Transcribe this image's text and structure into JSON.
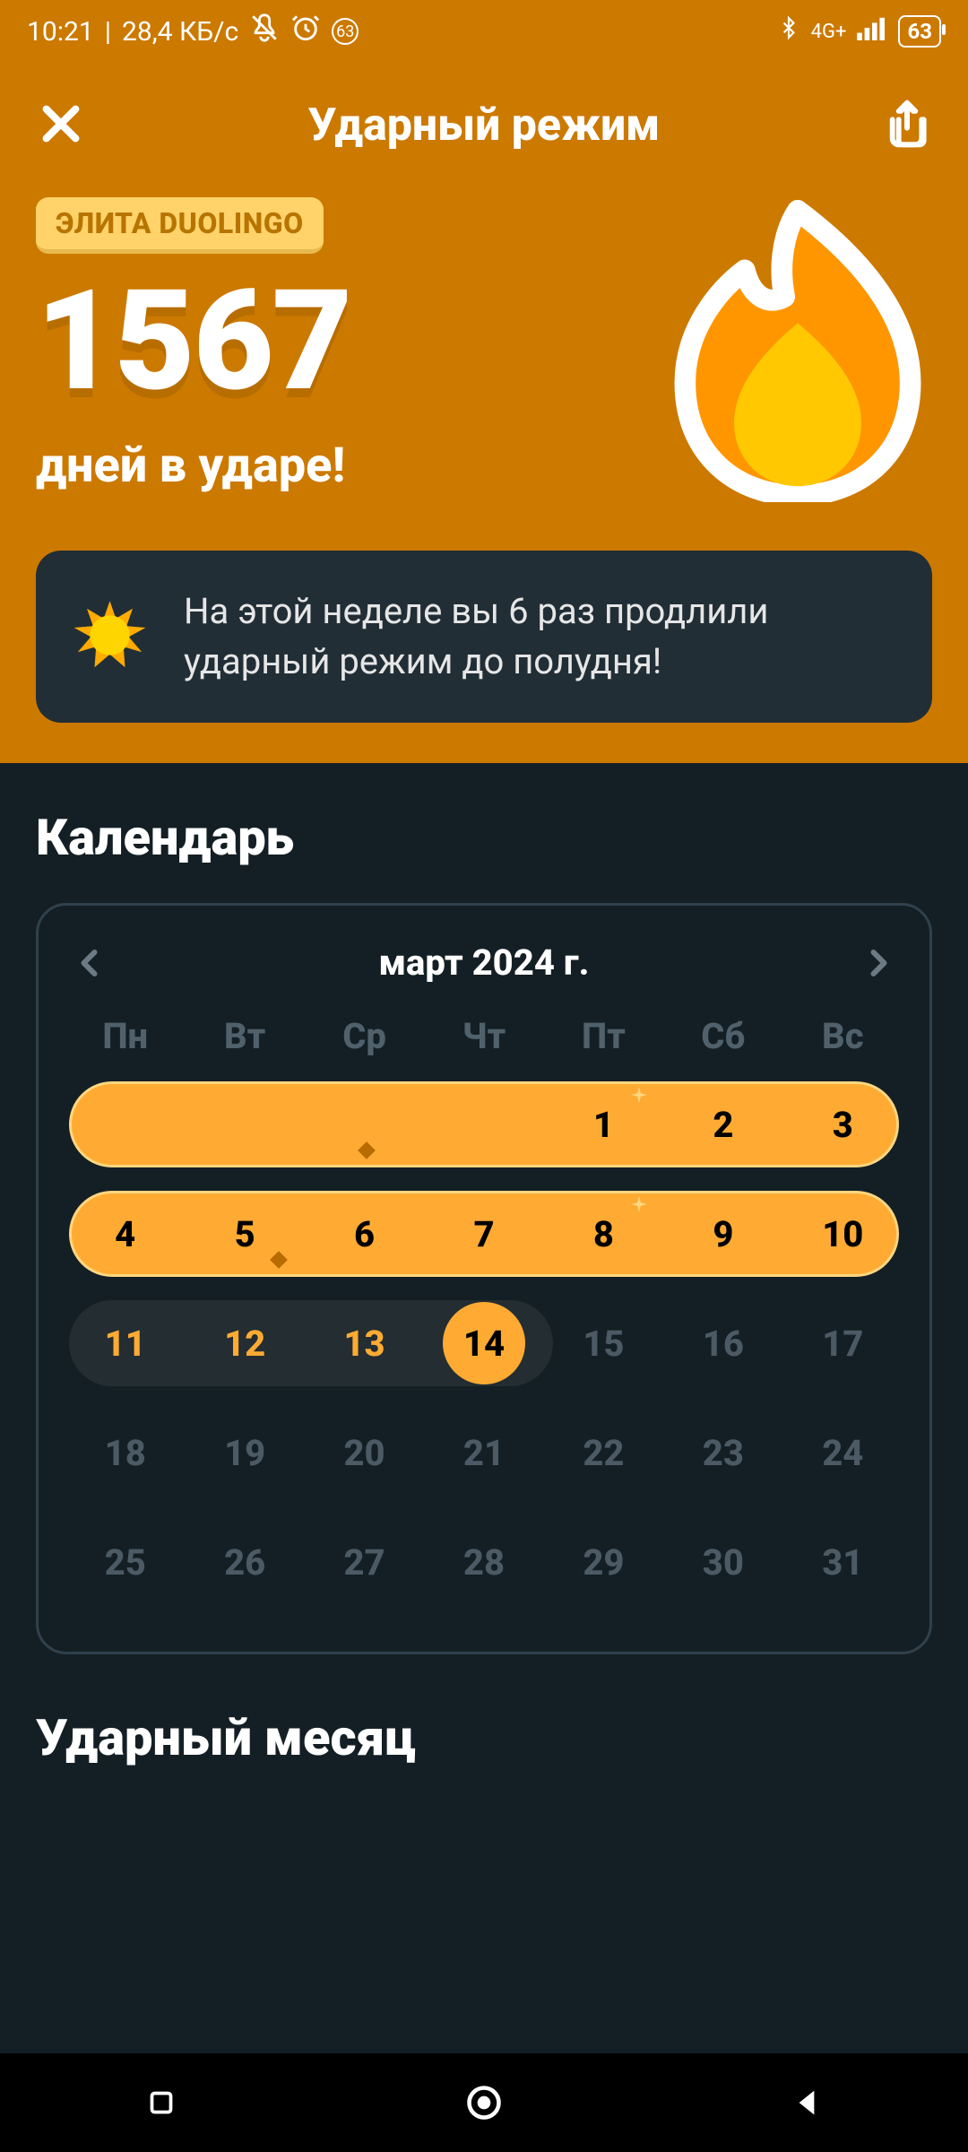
{
  "status": {
    "time": "10:21",
    "speed": "28,4 КБ/с",
    "network": "4G+",
    "battery": "63"
  },
  "header": {
    "title": "Ударный режим"
  },
  "streak": {
    "elite_badge": "ЭЛИТА DUOLINGO",
    "count": "1567",
    "subtitle": "дней в ударе!"
  },
  "info": {
    "text": "На этой неделе вы 6 раз продлили ударный режим до полудня!"
  },
  "calendar": {
    "section_title": "Календарь",
    "month_label": "март 2024 г.",
    "weekdays": [
      "Пн",
      "Вт",
      "Ср",
      "Чт",
      "Пт",
      "Сб",
      "Вс"
    ],
    "weeks": [
      [
        "",
        "",
        "",
        "",
        "1",
        "2",
        "3"
      ],
      [
        "4",
        "5",
        "6",
        "7",
        "8",
        "9",
        "10"
      ],
      [
        "11",
        "12",
        "13",
        "14",
        "15",
        "16",
        "17"
      ],
      [
        "18",
        "19",
        "20",
        "21",
        "22",
        "23",
        "24"
      ],
      [
        "25",
        "26",
        "27",
        "28",
        "29",
        "30",
        "31"
      ]
    ]
  },
  "month_section": {
    "title": "Ударный месяц"
  },
  "colors": {
    "orange": "#cc7900",
    "accent": "#ffab33",
    "dark": "#141f25"
  }
}
